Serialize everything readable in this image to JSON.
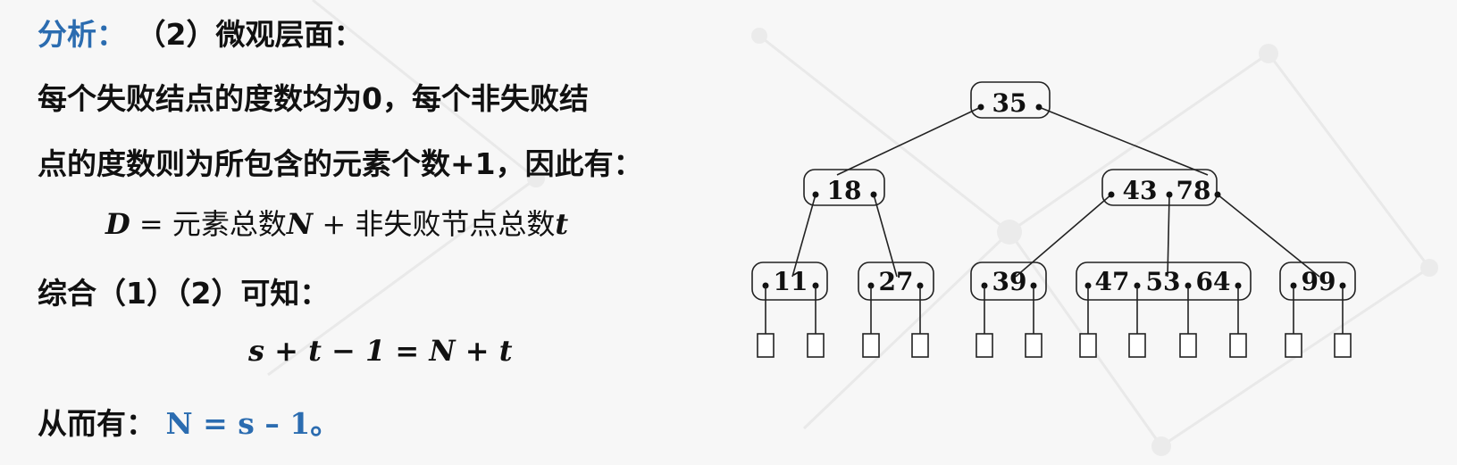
{
  "heading": {
    "label": "分析：",
    "text": "（2）微观层面："
  },
  "para1_line1": "每个失败结点的度数均为0，每个非失败结",
  "para1_line2": "点的度数则为所包含的元素个数+1，因此有：",
  "formula1": {
    "lhs": "D",
    "eq": "=",
    "term1": "元素总数",
    "var1": "N",
    "plus": "+",
    "term2": "非失败节点总数",
    "var2": "t"
  },
  "combine": "综合（1）（2）可知：",
  "formula2": "s + t − 1 = N + t",
  "conclusion": {
    "label": "从而有：",
    "result": "N = s – 1。"
  },
  "tree": {
    "root": [
      "35"
    ],
    "level2": [
      [
        "18"
      ],
      [
        "43",
        "78"
      ]
    ],
    "level3": [
      [
        "11"
      ],
      [
        "27"
      ],
      [
        "39"
      ],
      [
        "47",
        "53",
        "64"
      ],
      [
        "99"
      ]
    ]
  },
  "colors": {
    "accent": "#2b6cb0",
    "text": "#111111",
    "background": "#f7f7f7"
  }
}
